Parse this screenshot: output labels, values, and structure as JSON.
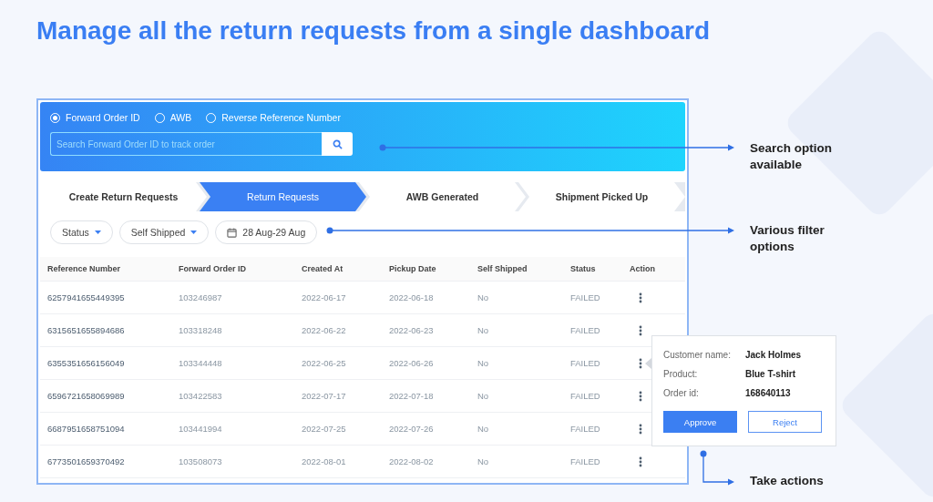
{
  "heading": "Manage all the return requests from a single dashboard",
  "search": {
    "options": [
      {
        "label": "Forward Order ID",
        "selected": true
      },
      {
        "label": "AWB",
        "selected": false
      },
      {
        "label": "Reverse Reference Number",
        "selected": false
      }
    ],
    "placeholder": "Search Forward Order ID to track order"
  },
  "steps": [
    {
      "label": "Create Return Requests",
      "selected": false
    },
    {
      "label": "Return Requests",
      "selected": true
    },
    {
      "label": "AWB Generated",
      "selected": false
    },
    {
      "label": "Shipment Picked Up",
      "selected": false
    }
  ],
  "filters": [
    {
      "kind": "dropdown",
      "label": "Status"
    },
    {
      "kind": "dropdown",
      "label": "Self Shipped"
    },
    {
      "kind": "date",
      "label": "28 Aug-29 Aug"
    }
  ],
  "table": {
    "columns": [
      "Reference Number",
      "Forward Order ID",
      "Created At",
      "Pickup Date",
      "Self Shipped",
      "Status",
      "Action"
    ],
    "rows": [
      {
        "cells": [
          "6257941655449395",
          "103246987",
          "2022-06-17",
          "2022-06-18",
          "No",
          "FAILED"
        ]
      },
      {
        "cells": [
          "6315651655894686",
          "103318248",
          "2022-06-22",
          "2022-06-23",
          "No",
          "FAILED"
        ]
      },
      {
        "cells": [
          "6355351656156049",
          "103344448",
          "2022-06-25",
          "2022-06-26",
          "No",
          "FAILED"
        ]
      },
      {
        "cells": [
          "6596721658069989",
          "103422583",
          "2022-07-17",
          "2022-07-18",
          "No",
          "FAILED"
        ]
      },
      {
        "cells": [
          "6687951658751094",
          "103441994",
          "2022-07-25",
          "2022-07-26",
          "No",
          "FAILED"
        ]
      },
      {
        "cells": [
          "6773501659370492",
          "103508073",
          "2022-08-01",
          "2022-08-02",
          "No",
          "FAILED"
        ]
      }
    ]
  },
  "popup": {
    "fields": [
      {
        "label": "Customer name:",
        "value": "Jack Holmes"
      },
      {
        "label": "Product:",
        "value": "Blue T-shirt"
      },
      {
        "label": "Order id:",
        "value": "168640113"
      }
    ],
    "buttons": [
      {
        "kind": "primary",
        "label": "Approve"
      },
      {
        "kind": "secondary",
        "label": "Reject"
      }
    ]
  },
  "callouts": [
    "Search option available",
    "Various filter options",
    "Take actions"
  ]
}
